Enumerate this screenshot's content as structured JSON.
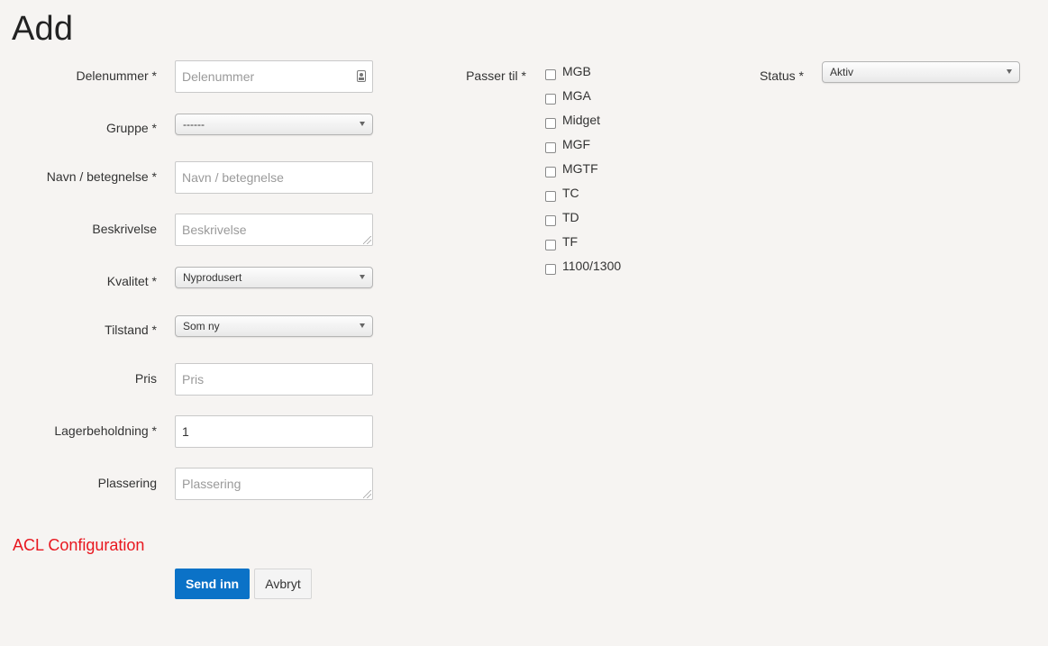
{
  "page": {
    "title": "Add"
  },
  "form": {
    "delenummer": {
      "label": "Delenummer *",
      "placeholder": "Delenummer",
      "value": ""
    },
    "gruppe": {
      "label": "Gruppe *",
      "selected": "------"
    },
    "navn": {
      "label": "Navn / betegnelse *",
      "placeholder": "Navn / betegnelse",
      "value": ""
    },
    "beskrivelse": {
      "label": "Beskrivelse",
      "placeholder": "Beskrivelse",
      "value": ""
    },
    "kvalitet": {
      "label": "Kvalitet *",
      "selected": "Nyprodusert"
    },
    "tilstand": {
      "label": "Tilstand *",
      "selected": "Som ny"
    },
    "pris": {
      "label": "Pris",
      "placeholder": "Pris",
      "value": ""
    },
    "lagerbeholdning": {
      "label": "Lagerbeholdning *",
      "placeholder": "",
      "value": "1"
    },
    "plassering": {
      "label": "Plassering",
      "placeholder": "Plassering",
      "value": ""
    },
    "passer_til": {
      "label": "Passer til *",
      "options": [
        {
          "label": "MGB",
          "checked": false
        },
        {
          "label": "MGA",
          "checked": false
        },
        {
          "label": "Midget",
          "checked": false
        },
        {
          "label": "MGF",
          "checked": false
        },
        {
          "label": "MGTF",
          "checked": false
        },
        {
          "label": "TC",
          "checked": false
        },
        {
          "label": "TD",
          "checked": false
        },
        {
          "label": "TF",
          "checked": false
        },
        {
          "label": "1100/1300",
          "checked": false
        }
      ]
    },
    "status": {
      "label": "Status *",
      "selected": "Aktiv"
    }
  },
  "acl": {
    "heading": "ACL Configuration"
  },
  "actions": {
    "submit_label": "Send inn",
    "cancel_label": "Avbryt"
  },
  "colors": {
    "accent": "#0b72c7",
    "acl_heading": "#e8171f",
    "background": "#f6f4f2"
  }
}
